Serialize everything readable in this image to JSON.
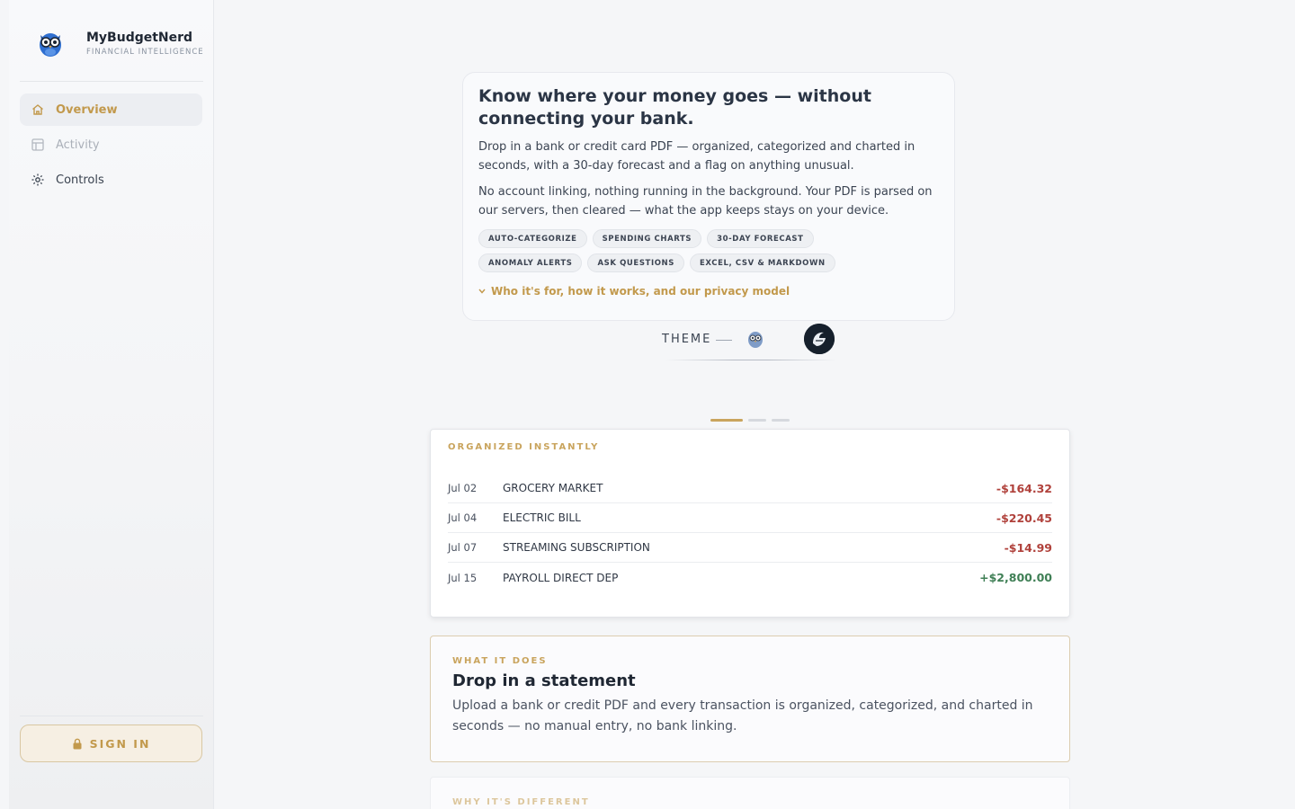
{
  "app": {
    "name": "MyBudgetNerd",
    "tagline": "FINANCIAL INTELLIGENCE",
    "accent_color": "#c2994c"
  },
  "sidebar": {
    "items": [
      {
        "label": "Overview",
        "icon": "home-icon",
        "state": "active"
      },
      {
        "label": "Activity",
        "icon": "table-icon",
        "state": "disabled"
      },
      {
        "label": "Controls",
        "icon": "settings-sparkle-icon",
        "state": "normal"
      }
    ],
    "signin_label": "SIGN IN"
  },
  "hero": {
    "title": "Know where your money goes — without connecting your bank.",
    "paragraph1": "Drop in a bank or credit card PDF — organized, categorized and charted in seconds, with a 30-day forecast and a flag on anything unusual.",
    "paragraph2": "No account linking, nothing running in the background. Your PDF is parsed on our servers, then cleared — what the app keeps stays on your device.",
    "chips": [
      "AUTO-CATEGORIZE",
      "SPENDING CHARTS",
      "30-DAY FORECAST",
      "ANOMALY ALERTS",
      "ASK QUESTIONS",
      "EXCEL, CSV & MARKDOWN"
    ],
    "more_link": "Who it's for, how it works, and our privacy model"
  },
  "theme": {
    "label": "THEME",
    "options": [
      "owl-theme-icon",
      "dark-theme-icon"
    ]
  },
  "carousel": {
    "slide_count": 3,
    "active_index": 0
  },
  "transactions_card": {
    "eyebrow": "ORGANIZED INSTANTLY",
    "rows": [
      {
        "date": "Jul 02",
        "description": "GROCERY MARKET",
        "amount": "-$164.32",
        "type": "neg"
      },
      {
        "date": "Jul 04",
        "description": "ELECTRIC BILL",
        "amount": "-$220.45",
        "type": "neg"
      },
      {
        "date": "Jul 07",
        "description": "STREAMING SUBSCRIPTION",
        "amount": "-$14.99",
        "type": "neg"
      },
      {
        "date": "Jul 15",
        "description": "PAYROLL DIRECT DEP",
        "amount": "+$2,800.00",
        "type": "pos"
      }
    ]
  },
  "feature_card": {
    "eyebrow": "WHAT IT DOES",
    "title": "Drop in a statement",
    "description": "Upload a bank or credit PDF and every transaction is organized, categorized, and charted in seconds — no manual entry, no bank linking."
  },
  "feature_card2": {
    "eyebrow": "WHY IT'S DIFFERENT"
  }
}
